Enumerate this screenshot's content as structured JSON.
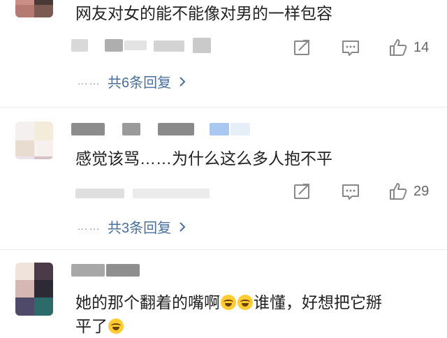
{
  "comments": [
    {
      "text": "网友对女的能不能像对男的一样包容",
      "comment_icon": "comment-icon",
      "share_icon": "share-icon",
      "like_icon": "thumbs-up-icon",
      "likes": "14",
      "replies_label": "共6条回复",
      "replies_dots": "……"
    },
    {
      "text": "感觉该骂……为什么这么多人抱不平",
      "likes": "29",
      "replies_label": "共3条回复",
      "replies_dots": "……"
    },
    {
      "text_line1": "她的那个翻着的嘴啊",
      "text_line1b": "谁懂，好想把它掰",
      "text_line2": "平了"
    }
  ],
  "colors": {
    "link": "#4a6f9e",
    "icon": "#888888",
    "text": "#222222"
  }
}
